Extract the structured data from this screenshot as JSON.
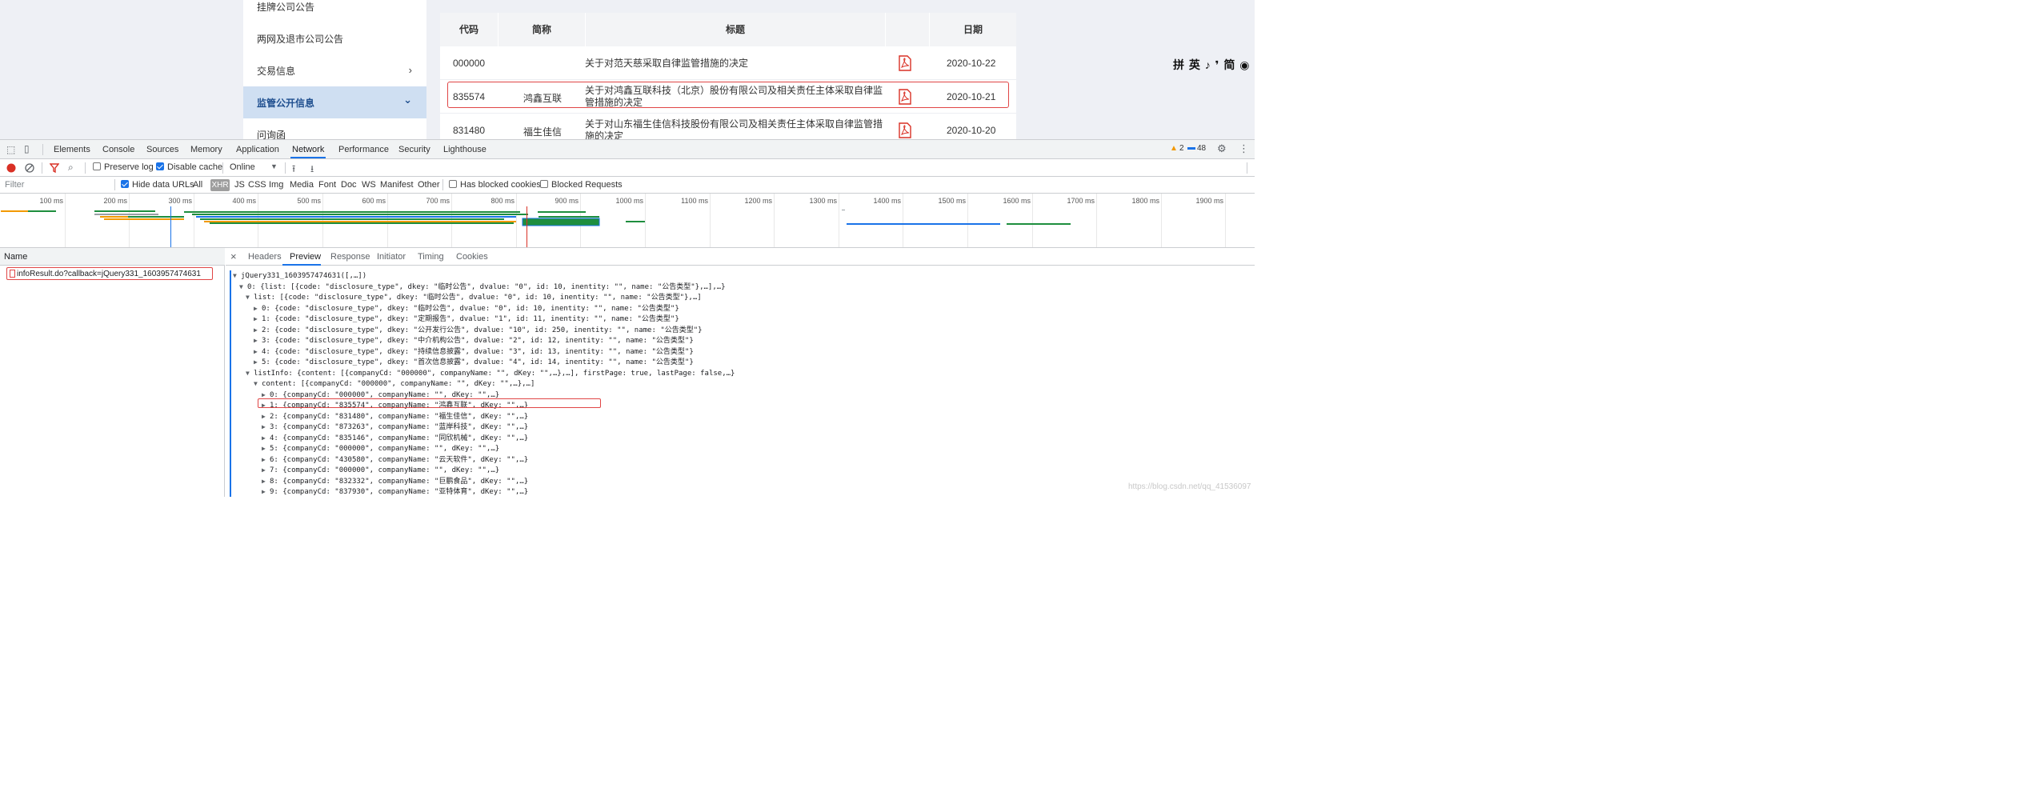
{
  "webpage": {
    "sidebar": {
      "items": [
        {
          "label": "挂牌公司公告",
          "chevron": ""
        },
        {
          "label": "两网及退市公司公告",
          "chevron": ""
        },
        {
          "label": "交易信息",
          "chevron": "›"
        },
        {
          "label": "监管公开信息",
          "chevron": "⌄"
        },
        {
          "label": "问询函",
          "chevron": ""
        }
      ]
    },
    "table": {
      "headers": [
        "代码",
        "简称",
        "标题",
        "",
        "日期"
      ],
      "rows": [
        {
          "code": "000000",
          "name": "",
          "title": "关于对范天慈采取自律监管措施的决定",
          "date": "2020-10-22"
        },
        {
          "code": "835574",
          "name": "鸿鑫互联",
          "title": "关于对鸿鑫互联科技（北京）股份有限公司及相关责任主体采取自律监管措施的决定",
          "date": "2020-10-21"
        },
        {
          "code": "831480",
          "name": "福生佳信",
          "title": "关于对山东福生佳信科技股份有限公司及相关责任主体采取自律监管措施的决定",
          "date": "2020-10-20"
        }
      ]
    },
    "ext_icons": "拼 英 ♪ ❜ 简 ◉"
  },
  "devtools": {
    "tabs": [
      "Elements",
      "Console",
      "Sources",
      "Memory",
      "Application",
      "Network",
      "Performance",
      "Security",
      "Lighthouse"
    ],
    "active_tab": "Network",
    "warnings_count": "2",
    "messages_count": "48",
    "toolbar": {
      "preserve_log": "Preserve log",
      "disable_cache": "Disable cache",
      "throttle": "Online"
    },
    "filter": {
      "placeholder": "Filter",
      "hide_data_urls": "Hide data URLs",
      "types": [
        "All",
        "XHR",
        "JS",
        "CSS",
        "Img",
        "Media",
        "Font",
        "Doc",
        "WS",
        "Manifest",
        "Other"
      ],
      "active_type": "XHR",
      "has_blocked_cookies": "Has blocked cookies",
      "blocked_requests": "Blocked Requests"
    },
    "timeline_ticks": [
      "100 ms",
      "200 ms",
      "300 ms",
      "400 ms",
      "500 ms",
      "600 ms",
      "700 ms",
      "800 ms",
      "900 ms",
      "1000 ms",
      "1100 ms",
      "1200 ms",
      "1300 ms",
      "1400 ms",
      "1500 ms",
      "1600 ms",
      "1700 ms",
      "1800 ms",
      "1900 ms"
    ],
    "requests_header": "Name",
    "request_name": "infoResult.do?callback=jQuery331_1603957474631",
    "preview_tabs": [
      "Headers",
      "Preview",
      "Response",
      "Initiator",
      "Timing",
      "Cookies"
    ],
    "active_preview_tab": "Preview",
    "json_lines": [
      {
        "tri": "▼",
        "text": "jQuery331_1603957474631([,…])"
      },
      {
        "tri": "▼",
        "text": "0: {list: [{code: \"disclosure_type\", dkey: \"临时公告\", dvalue: \"0\", id: 10, inentity: \"\", name: \"公告类型\"},…],…}"
      },
      {
        "tri": "▼",
        "text": "list: [{code: \"disclosure_type\", dkey: \"临时公告\", dvalue: \"0\", id: 10, inentity: \"\", name: \"公告类型\"},…]"
      },
      {
        "tri": "▶",
        "text": "0: {code: \"disclosure_type\", dkey: \"临时公告\", dvalue: \"0\", id: 10, inentity: \"\", name: \"公告类型\"}"
      },
      {
        "tri": "▶",
        "text": "1: {code: \"disclosure_type\", dkey: \"定期报告\", dvalue: \"1\", id: 11, inentity: \"\", name: \"公告类型\"}"
      },
      {
        "tri": "▶",
        "text": "2: {code: \"disclosure_type\", dkey: \"公开发行公告\", dvalue: \"10\", id: 250, inentity: \"\", name: \"公告类型\"}"
      },
      {
        "tri": "▶",
        "text": "3: {code: \"disclosure_type\", dkey: \"中介机构公告\", dvalue: \"2\", id: 12, inentity: \"\", name: \"公告类型\"}"
      },
      {
        "tri": "▶",
        "text": "4: {code: \"disclosure_type\", dkey: \"持续信息披露\", dvalue: \"3\", id: 13, inentity: \"\", name: \"公告类型\"}"
      },
      {
        "tri": "▶",
        "text": "5: {code: \"disclosure_type\", dkey: \"首次信息披露\", dvalue: \"4\", id: 14, inentity: \"\", name: \"公告类型\"}"
      },
      {
        "tri": "▼",
        "text": "listInfo: {content: [{companyCd: \"000000\", companyName: \"\", dKey: \"\",…},…], firstPage: true, lastPage: false,…}"
      },
      {
        "tri": "▼",
        "text": "content: [{companyCd: \"000000\", companyName: \"\", dKey: \"\",…},…]"
      },
      {
        "tri": "▶",
        "text": "0: {companyCd: \"000000\", companyName: \"\", dKey: \"\",…}"
      },
      {
        "tri": "▶",
        "text": "1: {companyCd: \"835574\", companyName: \"鸿鑫互联\", dKey: \"\",…}"
      },
      {
        "tri": "▶",
        "text": "2: {companyCd: \"831480\", companyName: \"福生佳信\", dKey: \"\",…}"
      },
      {
        "tri": "▶",
        "text": "3: {companyCd: \"873263\", companyName: \"蓝岸科技\", dKey: \"\",…}"
      },
      {
        "tri": "▶",
        "text": "4: {companyCd: \"835146\", companyName: \"同欣机械\", dKey: \"\",…}"
      },
      {
        "tri": "▶",
        "text": "5: {companyCd: \"000000\", companyName: \"\", dKey: \"\",…}"
      },
      {
        "tri": "▶",
        "text": "6: {companyCd: \"430580\", companyName: \"云天软件\", dKey: \"\",…}"
      },
      {
        "tri": "▶",
        "text": "7: {companyCd: \"000000\", companyName: \"\", dKey: \"\",…}"
      },
      {
        "tri": "▶",
        "text": "8: {companyCd: \"832332\", companyName: \"巨鹏食品\", dKey: \"\",…}"
      },
      {
        "tri": "▶",
        "text": "9: {companyCd: \"837930\", companyName: \"亚特体育\", dKey: \"\",…}"
      }
    ]
  },
  "watermark": "https://blog.csdn.net/qq_41536097",
  "colors": {
    "accent": "#1a73e8",
    "highlight_red": "#e04545",
    "nav_active_bg": "#cfdff2",
    "pdf_red": "#d93025"
  }
}
